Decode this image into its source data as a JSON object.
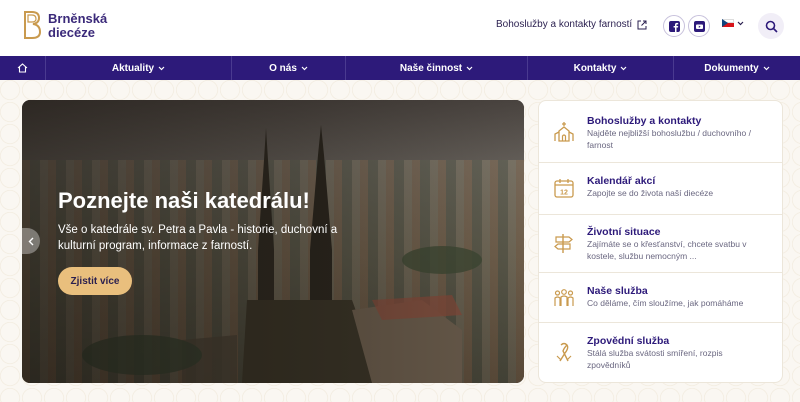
{
  "brand": {
    "line1": "Brněnská",
    "line2": "diecéze"
  },
  "header": {
    "top_link": "Bohoslužby a kontakty farností",
    "social": [
      "facebook-icon",
      "youtube-icon"
    ],
    "lang_flag": "cz-flag"
  },
  "nav": {
    "items": [
      {
        "label": "Aktuality"
      },
      {
        "label": "O nás"
      },
      {
        "label": "Naše činnost"
      },
      {
        "label": "Kontakty"
      },
      {
        "label": "Dokumenty"
      }
    ]
  },
  "hero": {
    "title": "Poznejte naši katedrálu!",
    "text": "Vše o katedrále sv. Petra a Pavla - historie, duchovní a kulturní program, informace z farností.",
    "button": "Zjistit více"
  },
  "cards": [
    {
      "title": "Bohoslužby a kontakty",
      "desc": "Najděte nejbližší bohoslužbu / duchovního / farnost",
      "icon": "church-icon"
    },
    {
      "title": "Kalendář akcí",
      "desc": "Zapojte se do života naší diecéze",
      "icon": "calendar-icon"
    },
    {
      "title": "Životní situace",
      "desc": "Zajímáte se o křesťanství, chcete svatbu v kostele, službu nemocným ...",
      "icon": "signpost-icon"
    },
    {
      "title": "Naše služba",
      "desc": "Co děláme, čím sloužíme, jak pomáháme",
      "icon": "people-icon"
    },
    {
      "title": "Zpovědní služba",
      "desc": "Stálá služba svátosti smíření, rozpis zpovědníků",
      "icon": "ribbon-icon"
    }
  ],
  "colors": {
    "primary": "#2d1a7a",
    "accent": "#e9bf7d",
    "gold": "#c99a4e"
  }
}
